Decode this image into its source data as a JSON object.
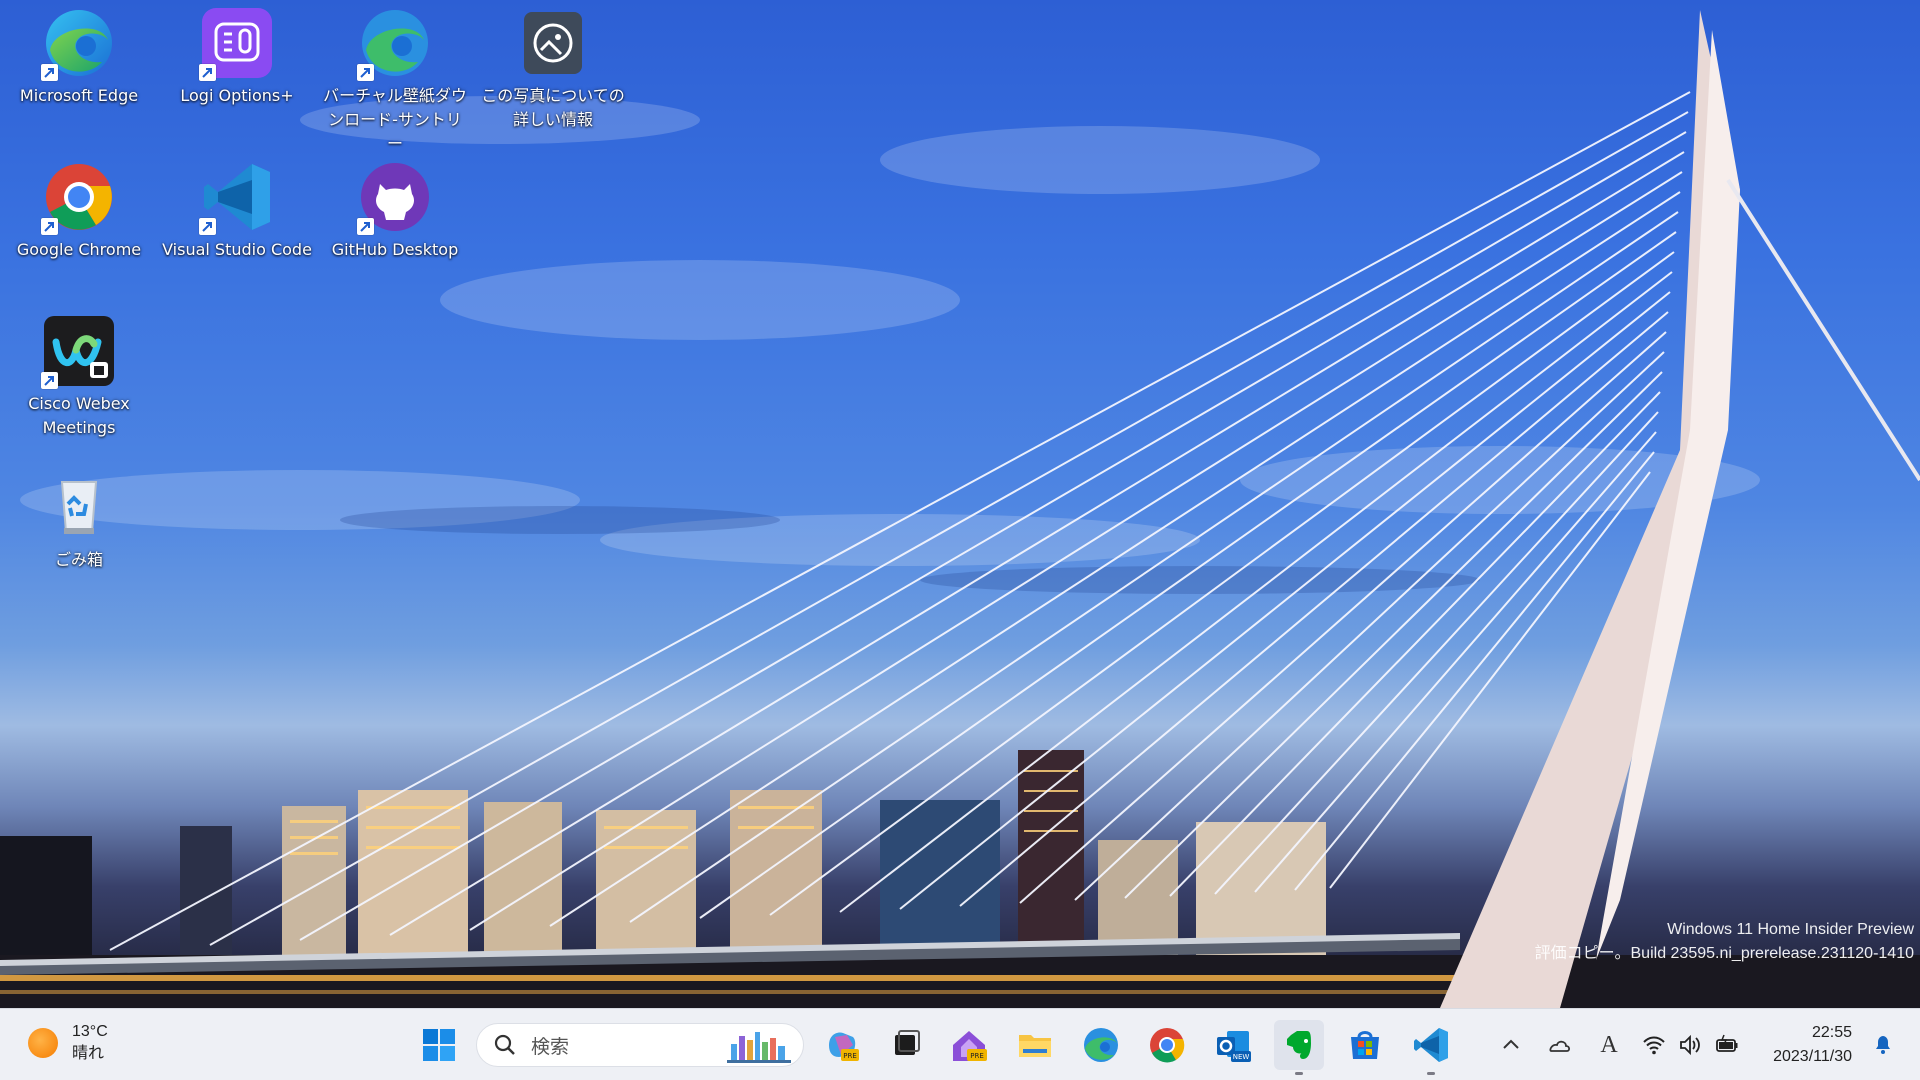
{
  "desktop": {
    "icons": [
      {
        "label": "Microsoft Edge",
        "icon": "edge-icon"
      },
      {
        "label": "Logi Options+",
        "icon": "logi-options-icon"
      },
      {
        "label": "バーチャル壁紙ダウンロード-サントリー",
        "icon": "edge-icon"
      },
      {
        "label": "この写真についての詳しい情報",
        "icon": "photo-info-icon"
      },
      {
        "label": "Google Chrome",
        "icon": "chrome-icon"
      },
      {
        "label": "Visual Studio Code",
        "icon": "vscode-icon"
      },
      {
        "label": "GitHub Desktop",
        "icon": "github-icon"
      },
      {
        "label": "Cisco Webex Meetings",
        "icon": "webex-icon"
      },
      {
        "label": "ごみ箱",
        "icon": "recycle-bin-icon"
      }
    ]
  },
  "watermark": {
    "line1": "Windows 11 Home Insider Preview",
    "line2": "評価コピー。Build 23595.ni_prerelease.231120-1410"
  },
  "taskbar": {
    "weather": {
      "temp": "13°C",
      "condition": "晴れ",
      "icon": "sun-icon"
    },
    "search": {
      "placeholder": "検索"
    },
    "apps": [
      {
        "icon": "start-icon"
      },
      {
        "icon": "copilot-preview-icon"
      },
      {
        "icon": "task-view-icon"
      },
      {
        "icon": "dev-home-preview-icon"
      },
      {
        "icon": "file-explorer-icon"
      },
      {
        "icon": "edge-icon"
      },
      {
        "icon": "chrome-icon"
      },
      {
        "icon": "outlook-new-icon"
      },
      {
        "icon": "evernote-icon"
      },
      {
        "icon": "microsoft-store-icon"
      },
      {
        "icon": "vscode-icon"
      }
    ],
    "tray": {
      "icons": [
        "chevron-up-icon",
        "onedrive-icon",
        "ime-icon",
        "wifi-icon",
        "volume-icon",
        "battery-icon"
      ],
      "ime_label": "A",
      "time": "22:55",
      "date": "2023/11/30"
    }
  }
}
